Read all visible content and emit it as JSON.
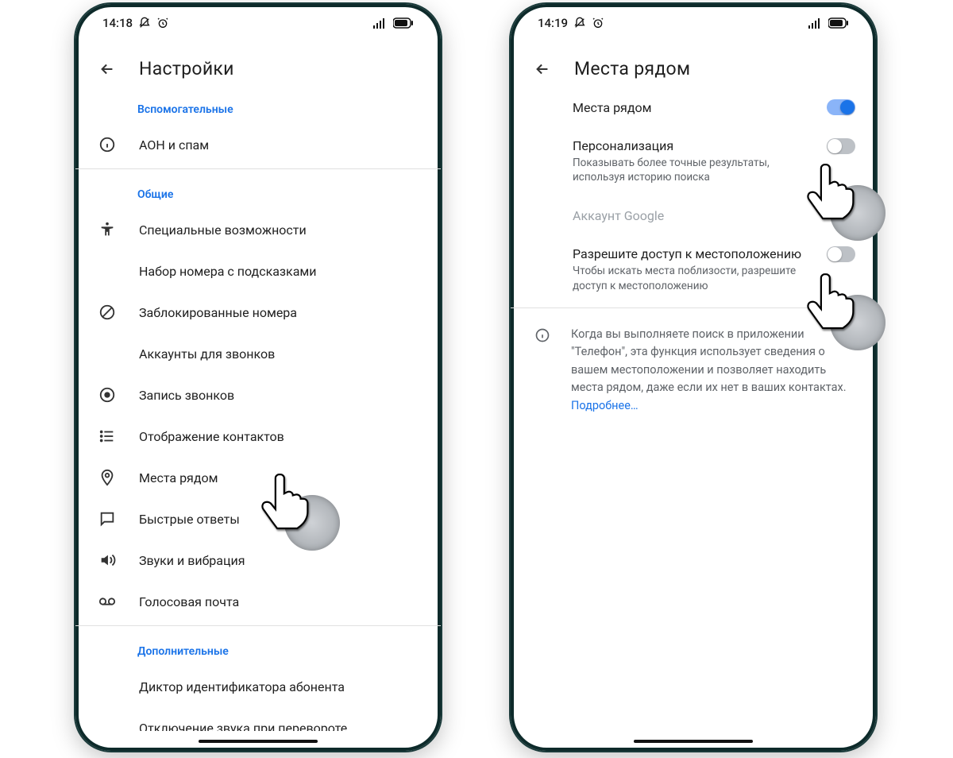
{
  "left": {
    "status_time": "14:18",
    "title": "Настройки",
    "sections": {
      "assist_label": "Вспомогательные",
      "general_label": "Общие",
      "extra_label": "Дополнительные"
    },
    "items": {
      "caller_id_spam": "АОН и спам",
      "accessibility": "Специальные возможности",
      "assisted_dialing": "Набор номера с подсказками",
      "blocked_numbers": "Заблокированные номера",
      "calling_accounts": "Аккаунты для звонков",
      "call_recording": "Запись звонков",
      "display_contacts": "Отображение контактов",
      "nearby_places": "Места рядом",
      "quick_responses": "Быстрые ответы",
      "sounds_vibration": "Звуки и вибрация",
      "voicemail": "Голосовая почта",
      "announce_caller": "Диктор идентификатора абонента",
      "flip_to_silence": "Отключение звука при перевороте"
    }
  },
  "right": {
    "status_time": "14:19",
    "title": "Места рядом",
    "toggles": {
      "nearby": {
        "label": "Места рядом",
        "on": true
      },
      "personalization": {
        "label": "Персонализация",
        "sub": "Показывать более точные результаты, используя историю поиска",
        "on": false
      },
      "google_account": "Аккаунт Google",
      "location_access": {
        "label": "Разрешите доступ к местоположению",
        "sub": "Чтобы искать места поблизости, разрешите доступ к местоположению",
        "on": false
      }
    },
    "info_text": "Когда вы выполняете поиск в приложении \"Телефон\", эта функция использует сведения о вашем местоположении и позволяет находить места рядом, даже если их нет в ваших контактах. ",
    "learn_more": "Подробнее…"
  }
}
